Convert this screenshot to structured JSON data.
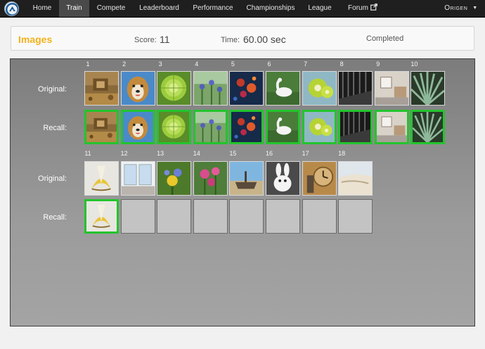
{
  "nav": {
    "items": [
      "Home",
      "Train",
      "Compete",
      "Leaderboard",
      "Performance",
      "Championships",
      "League",
      "Forum"
    ],
    "active": "Train",
    "user": "Origen"
  },
  "status": {
    "title": "Images",
    "score_label": "Score:",
    "score": "11",
    "time_label": "Time:",
    "time": "60.00 sec",
    "state": "Completed"
  },
  "board": {
    "original_label": "Original:",
    "recall_label": "Recall:",
    "rows": [
      {
        "numbers": [
          "1",
          "2",
          "3",
          "4",
          "5",
          "6",
          "7",
          "8",
          "9",
          "10"
        ],
        "originals": [
          "wood-ruins",
          "dog",
          "cabbage",
          "meadow-flowers",
          "night-lights",
          "swan",
          "kiwi-slices",
          "dark-forest",
          "room-shelf",
          "agave-plant"
        ],
        "recall": [
          "wood-ruins",
          "dog",
          "cabbage",
          "meadow-flowers",
          "night-lights",
          "swan",
          "kiwi-slices",
          "dark-forest",
          "room-shelf",
          "agave-plant"
        ],
        "recall_correct": [
          true,
          true,
          true,
          true,
          true,
          true,
          true,
          true,
          true,
          true
        ]
      },
      {
        "numbers": [
          "11",
          "12",
          "13",
          "14",
          "15",
          "16",
          "17",
          "18"
        ],
        "originals": [
          "banana",
          "bright-room",
          "yellow-blue-flower",
          "pink-flowers",
          "ship-wreck",
          "white-rabbit",
          "clock-statue",
          "beach-sand"
        ],
        "recall": [
          "banana",
          "",
          "",
          "",
          "",
          "",
          "",
          ""
        ],
        "recall_correct": [
          true,
          false,
          false,
          false,
          false,
          false,
          false,
          false
        ]
      }
    ]
  },
  "colors": {
    "accent": "#f2b21c",
    "correct": "#23c42d",
    "nav_bg": "#1f1f1f",
    "empty_tile": "#c3c3c3"
  }
}
